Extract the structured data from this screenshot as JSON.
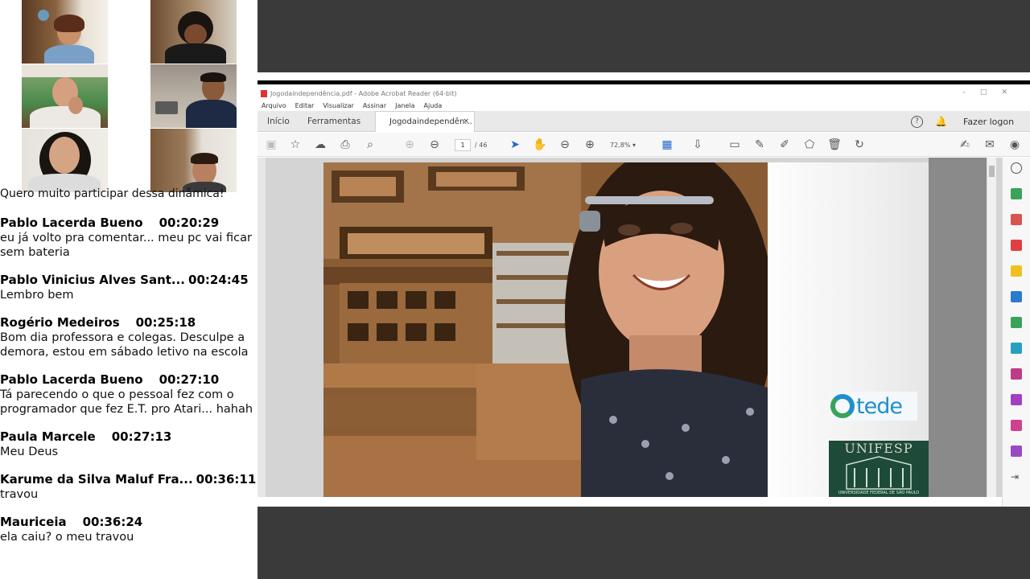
{
  "participants": [
    {
      "id": "p1"
    },
    {
      "id": "p2"
    },
    {
      "id": "p3"
    },
    {
      "id": "p4"
    },
    {
      "id": "p5"
    },
    {
      "id": "p6"
    }
  ],
  "chat": {
    "partial_text": "Quero muito participar dessa dinâmica!",
    "messages": [
      {
        "name": "Pablo Lacerda Bueno",
        "time": "00:20:29",
        "text": "eu já volto pra comentar... meu pc vai ficar sem bateria"
      },
      {
        "name": "Pablo Vinicius Alves Sant...",
        "time": "00:24:45",
        "text": "Lembro bem"
      },
      {
        "name": "Rogério Medeiros",
        "time": "00:25:18",
        "text": "Bom dia professora e colegas. Desculpe a demora, estou em sábado letivo na escola"
      },
      {
        "name": "Pablo Lacerda Bueno",
        "time": "00:27:10",
        "text": "Tá parecendo o que o pessoal fez com o programador que fez E.T. pro Atari... hahah"
      },
      {
        "name": "Paula Marcele",
        "time": "00:27:13",
        "text": "Meu Deus"
      },
      {
        "name": "Karume da Silva Maluf Fra...",
        "time": "00:36:11",
        "text": "travou"
      },
      {
        "name": "Mauriceia",
        "time": "00:36:24",
        "text": "ela caiu? o meu travou"
      }
    ]
  },
  "acrobat": {
    "window_title": "Jogodaindependência.pdf - Adobe Acrobat Reader (64-bit)",
    "menu": [
      "Arquivo",
      "Editar",
      "Visualizar",
      "Assinar",
      "Janela",
      "Ajuda"
    ],
    "tabs": {
      "home": "Início",
      "tools": "Ferramentas",
      "document": "Jogodaindependên...",
      "close": "×"
    },
    "help": "?",
    "login": "Fazer logon",
    "page_current": "1",
    "page_total": "/ 46",
    "zoom": "72,8%",
    "logos": {
      "tede": "tede",
      "unifesp": "UNIFESP",
      "unifesp_sub": "UNIVERSIDADE FEDERAL DE SÃO PAULO"
    }
  },
  "colors": {
    "accent_blue": "#1f8fc9",
    "dark_bg": "#3a3a3a"
  }
}
